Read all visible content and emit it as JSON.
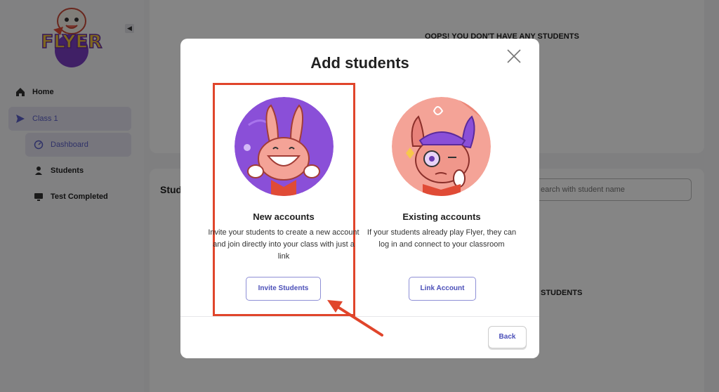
{
  "sidebar": {
    "items": [
      {
        "label": "Home",
        "icon": "home-icon"
      },
      {
        "label": "Class 1",
        "icon": "send-icon"
      },
      {
        "label": "Dashboard",
        "icon": "gauge-icon"
      },
      {
        "label": "Students",
        "icon": "person-icon"
      },
      {
        "label": "Test Completed",
        "icon": "monitor-icon"
      }
    ],
    "logo_text": "FLYER"
  },
  "background": {
    "empty_text": "OOPS! YOU DON'T HAVE ANY STUDENTS",
    "students_heading": "Stud",
    "search_placeholder": "earch with student name",
    "students_label": "STUDENTS"
  },
  "modal": {
    "title": "Add students",
    "options": [
      {
        "title": "New accounts",
        "description": "Invite your students to create a new account and join directly into your class with just a link",
        "button": "Invite Students"
      },
      {
        "title": "Existing accounts",
        "description": "If your students already play Flyer, they can log in and connect to your classroom",
        "button": "Link Account"
      }
    ],
    "back_label": "Back"
  },
  "colors": {
    "accent": "#4b4fb8",
    "highlight": "#e0452b",
    "purple": "#8a4fd8",
    "peach": "#f4a397"
  }
}
